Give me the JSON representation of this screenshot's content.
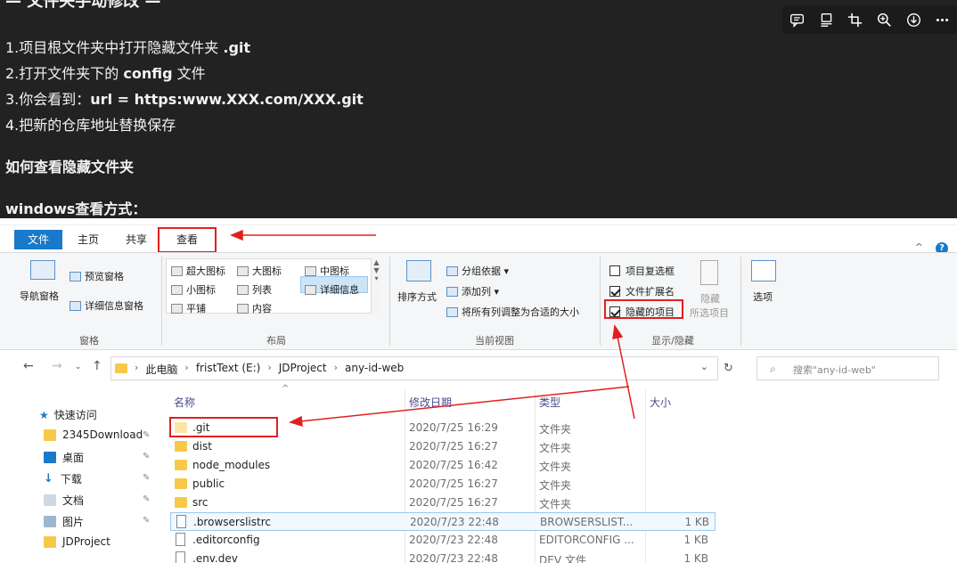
{
  "article": {
    "heading_partial": "— 文件夹手动修改 —",
    "steps": [
      {
        "text": "1.项目根文件夹中打开隐藏文件夹 ",
        "bold": ".git"
      },
      {
        "text": "2.打开文件夹下的 ",
        "bold": "config",
        "tail": " 文件"
      },
      {
        "text": "3.你会看到：",
        "bold": "url = https:www.XXX.com/XXX.git"
      },
      {
        "text": "4.把新的仓库地址替换保存"
      }
    ],
    "subheading1": "如何查看隐藏文件夹",
    "subheading2": "windows查看方式："
  },
  "image_toolbar": {
    "icons": [
      "comment-icon",
      "caption-icon",
      "crop-icon",
      "zoom-in-icon",
      "download-icon",
      "more-icon"
    ]
  },
  "explorer": {
    "tabs": [
      {
        "label": "文件",
        "active": true
      },
      {
        "label": "主页",
        "active": false
      },
      {
        "label": "共享",
        "active": false
      },
      {
        "label": "查看",
        "active": false
      }
    ],
    "ribbon": {
      "panes": {
        "nav_pane": "导航窗格",
        "preview_pane": "预览窗格",
        "details_pane": "详细信息窗格",
        "group": "窗格"
      },
      "layout": {
        "items": [
          "超大图标",
          "大图标",
          "中图标",
          "小图标",
          "列表",
          "详细信息",
          "平铺",
          "内容"
        ],
        "selected": "详细信息",
        "group": "布局"
      },
      "current_view": {
        "sort_by": "排序方式",
        "group_by": "分组依据 ▾",
        "add_column": "添加列 ▾",
        "fit_columns": "将所有列调整为合适的大小",
        "group": "当前视图"
      },
      "show_hide": {
        "item_checkboxes": {
          "label": "项目复选框",
          "checked": false
        },
        "file_extensions": {
          "label": "文件扩展名",
          "checked": true
        },
        "hidden_items": {
          "label": "隐藏的项目",
          "checked": true
        },
        "hide_selected": "隐藏",
        "hide_selected_2": "所选项目",
        "group": "显示/隐藏"
      },
      "options": "选项"
    },
    "address": {
      "crumbs": [
        "此电脑",
        "fristText (E:)",
        "JDProject",
        "any-id-web"
      ],
      "search_placeholder": "搜索\"any-id-web\""
    },
    "nav_pane": [
      {
        "label": "快速访问",
        "icon": "star-icon"
      },
      {
        "label": "2345Download",
        "icon": "folder-icon",
        "pinned": true
      },
      {
        "label": "桌面",
        "icon": "desktop-icon",
        "pinned": true
      },
      {
        "label": "下载",
        "icon": "download-icon",
        "pinned": true
      },
      {
        "label": "文档",
        "icon": "documents-icon",
        "pinned": true
      },
      {
        "label": "图片",
        "icon": "pictures-icon",
        "pinned": true
      },
      {
        "label": "JDProject",
        "icon": "folder-icon"
      }
    ],
    "columns": {
      "name": "名称",
      "date": "修改日期",
      "type": "类型",
      "size": "大小"
    },
    "files": [
      {
        "name": ".git",
        "date": "2020/7/25 16:29",
        "type": "文件夹",
        "size": "",
        "kind": "folder"
      },
      {
        "name": "dist",
        "date": "2020/7/25 16:27",
        "type": "文件夹",
        "size": "",
        "kind": "folder"
      },
      {
        "name": "node_modules",
        "date": "2020/7/25 16:42",
        "type": "文件夹",
        "size": "",
        "kind": "folder"
      },
      {
        "name": "public",
        "date": "2020/7/25 16:27",
        "type": "文件夹",
        "size": "",
        "kind": "folder"
      },
      {
        "name": "src",
        "date": "2020/7/25 16:27",
        "type": "文件夹",
        "size": "",
        "kind": "folder"
      },
      {
        "name": ".browserslistrc",
        "date": "2020/7/23 22:48",
        "type": "BROWSERSLIST...",
        "size": "1 KB",
        "kind": "file"
      },
      {
        "name": ".editorconfig",
        "date": "2020/7/23 22:48",
        "type": "EDITORCONFIG ...",
        "size": "1 KB",
        "kind": "file"
      },
      {
        "name": ".env.dev",
        "date": "2020/7/23 22:48",
        "type": "DEV 文件",
        "size": "1 KB",
        "kind": "file"
      }
    ],
    "colors": {
      "accent": "#1979ca",
      "annotation": "#e02020",
      "folder": "#f7c948"
    }
  }
}
